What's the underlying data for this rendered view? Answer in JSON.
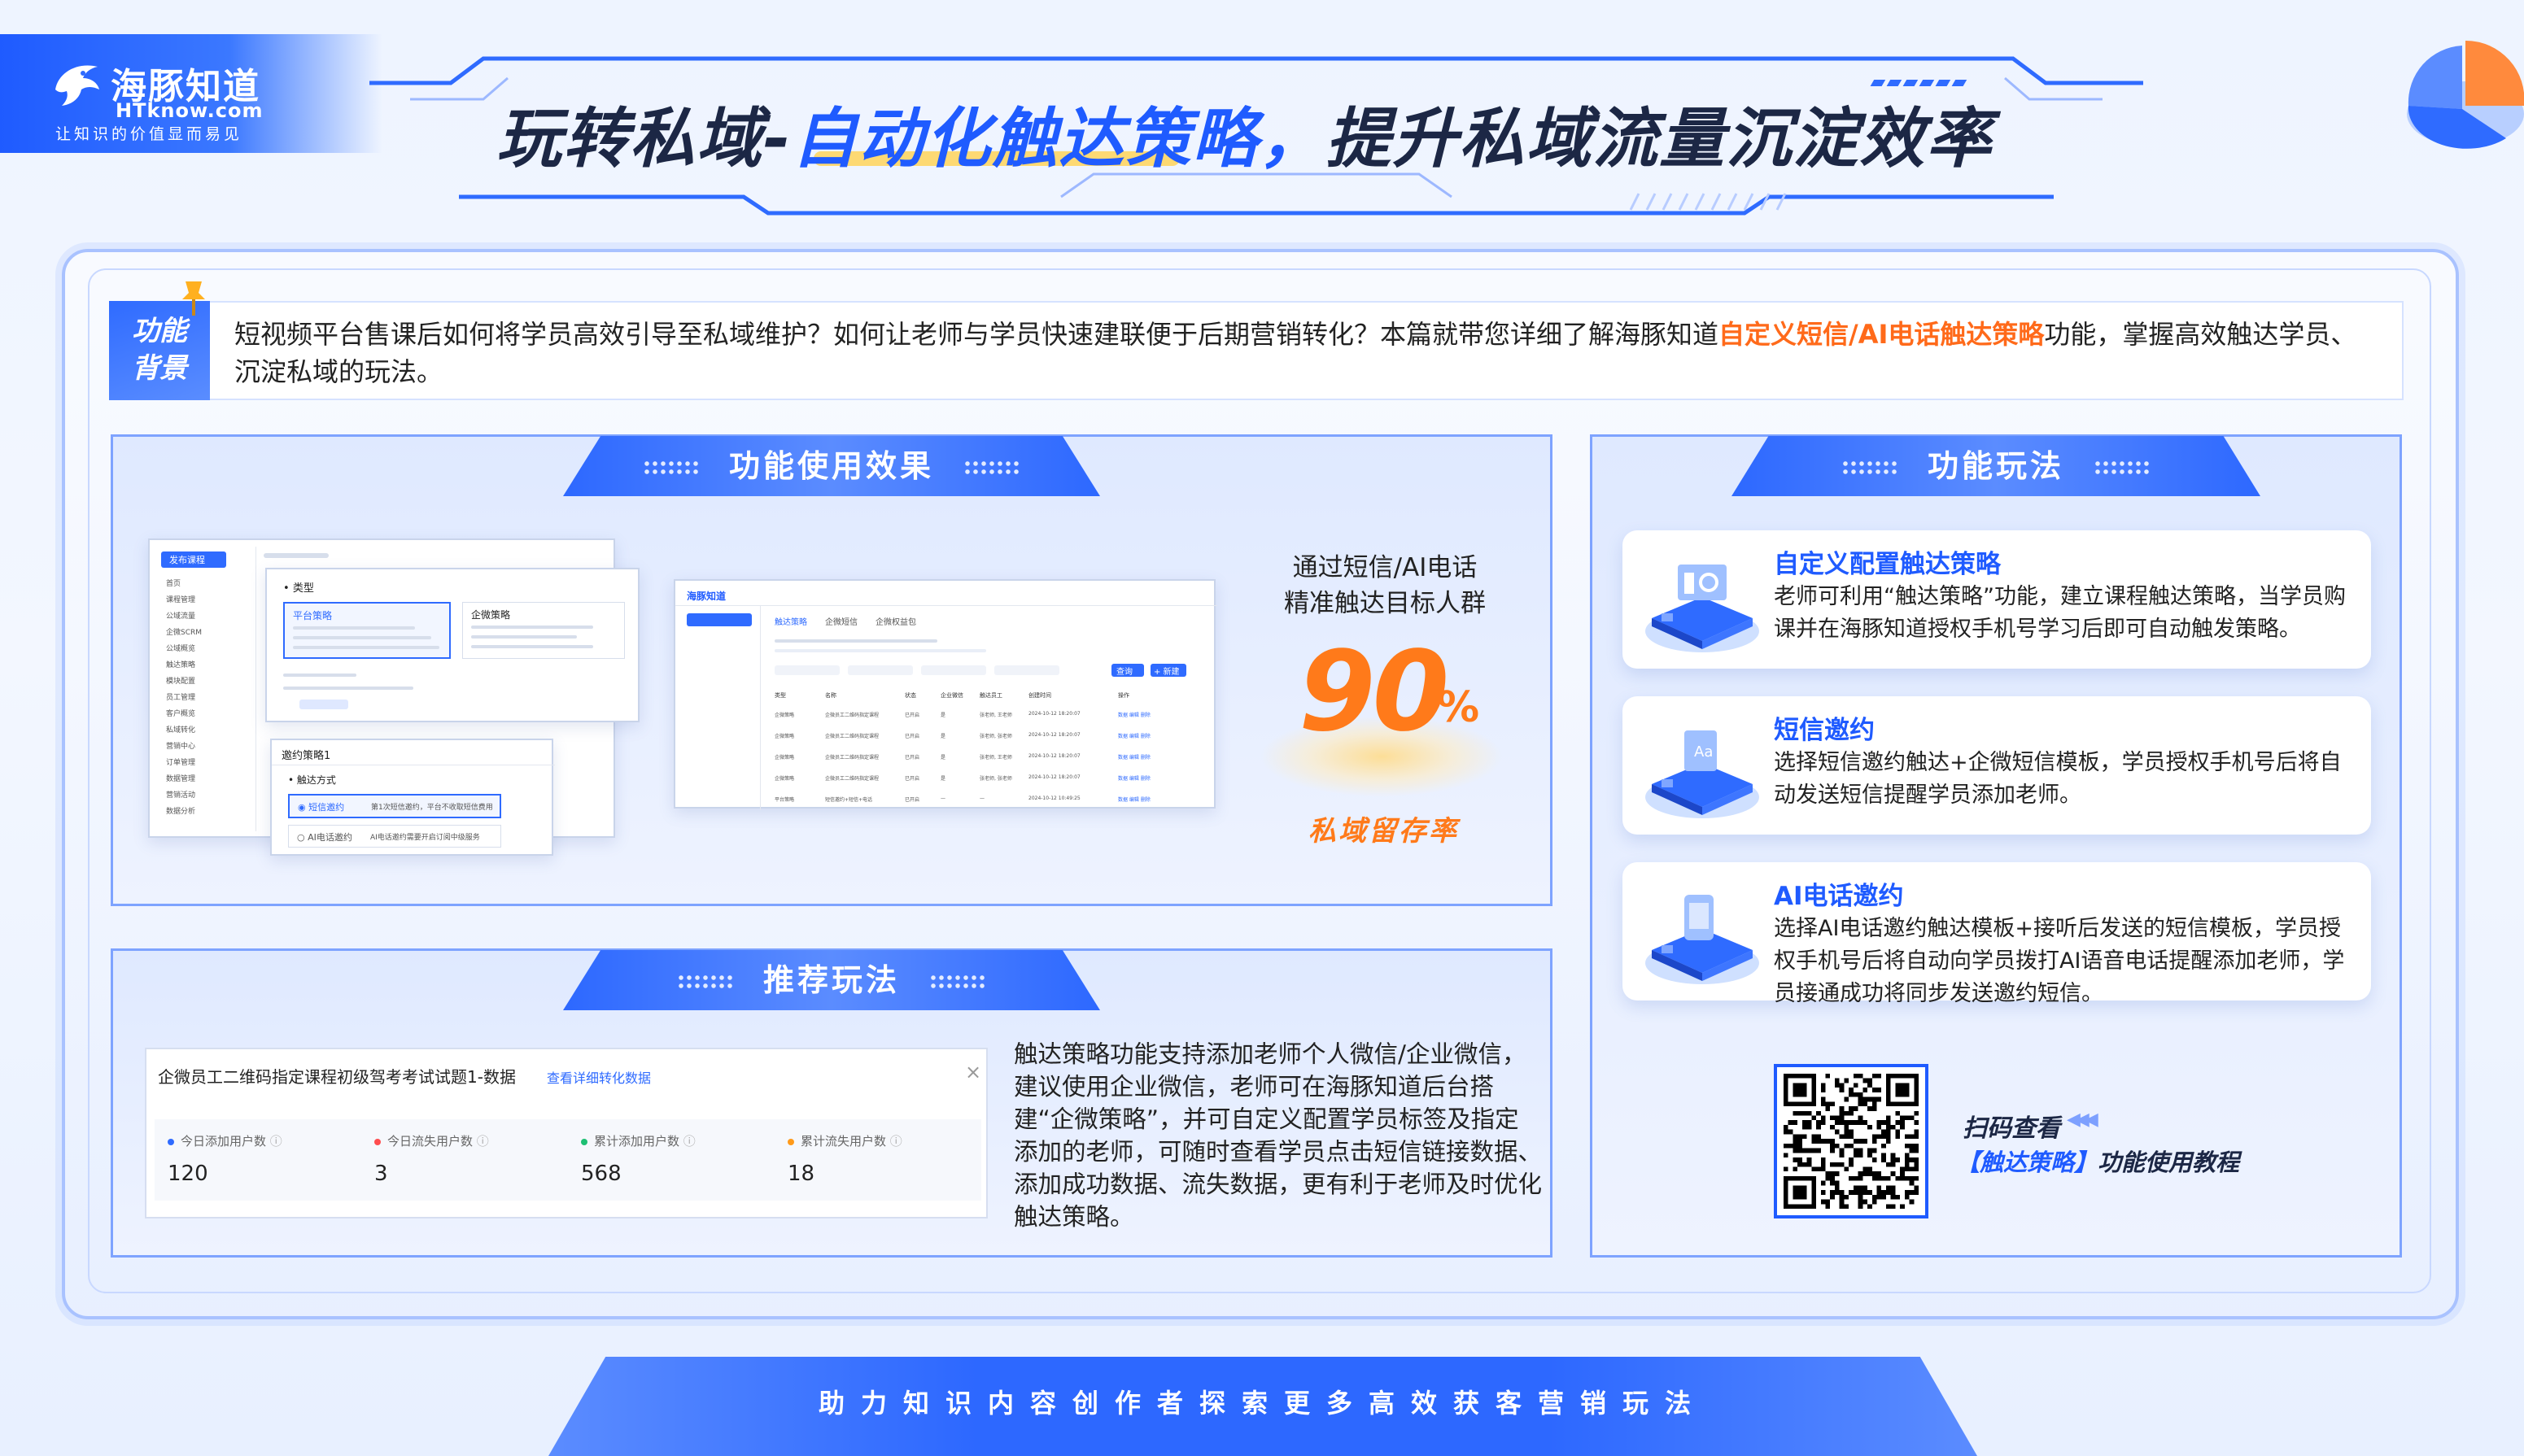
{
  "brand": {
    "name": "海豚知道",
    "domain": "HTknow.com",
    "slogan": "让知识的价值显而易见"
  },
  "header": {
    "title_part1": "玩转私域-",
    "title_part2": "自动化触达策略，",
    "title_part3": "提升私域流量沉淀效率"
  },
  "background": {
    "tag_line1": "功能",
    "tag_line2": "背景",
    "text_before": "短视频平台售课后如何将学员高效引导至私域维护？如何让老师与学员快速建联便于后期营销转化？本篇就带您详细了解海豚知道",
    "text_highlight": "自定义短信/AI电话触达策略",
    "text_after": "功能，掌握高效触达学员、沉淀私域的玩法。"
  },
  "effect": {
    "heading": "功能使用效果",
    "copy_line1": "通过短信/AI电话",
    "copy_line2": "精准触达目标人群",
    "number": "90",
    "unit": "%",
    "caption": "私域留存率",
    "shot1": {
      "menu": [
        "首页",
        "课程管理",
        "公域流量",
        "企微SCRM",
        "公域概览",
        "触达策略",
        "模块配置",
        "员工管理",
        "客户概览",
        "私域转化",
        "营销中心",
        "订单管理",
        "数据管理",
        "营销活动",
        "数据分析"
      ],
      "type_label": "类型",
      "opt1_title": "平台策略",
      "opt2_title": "企微策略",
      "popup_title": "邀约策略1",
      "popup_sub": "触达方式",
      "popup_opt1": "短信邀约",
      "popup_opt1_desc": "第1次短信邀约，平台不收取短信费用",
      "popup_opt2": "AI电话邀约",
      "popup_opt2_desc": "AI电话邀约需要开启订阅中级服务"
    },
    "shot2": {
      "logo": "海豚知道",
      "tabs": [
        "触达策略",
        "企微短信",
        "企微权益包"
      ],
      "search_btn": "查询",
      "add_btn": "+ 新建",
      "columns": [
        "类型",
        "名称",
        "状态",
        "企业微信",
        "触达员工",
        "创建时间",
        "操作"
      ],
      "rows": [
        [
          "企微策略",
          "企微员工二维码指定课程",
          "已开启",
          "是",
          "张老师, 王老师",
          "2024-10-12 18:20:07",
          "数据 编辑 删除"
        ],
        [
          "企微策略",
          "企微员工二维码指定课程",
          "已开启",
          "是",
          "张老师, 张老师",
          "2024-10-12 18:20:07",
          "数据 编辑 删除"
        ],
        [
          "企微策略",
          "企微员工二维码指定课程",
          "已开启",
          "是",
          "张老师, 王老师",
          "2024-10-12 18:20:07",
          "数据 编辑 删除"
        ],
        [
          "企微策略",
          "企微员工二维码指定课程",
          "已开启",
          "是",
          "张老师, 张老师",
          "2024-10-12 18:20:07",
          "数据 编辑 删除"
        ],
        [
          "平台策略",
          "短信邀约+短信+电话",
          "已开启",
          "—",
          "—",
          "2024-10-12 10:49:25",
          "数据 编辑 删除"
        ]
      ]
    }
  },
  "recommend": {
    "heading": "推荐玩法",
    "card_title": "企微员工二维码指定课程初级驾考考试试题1-数据",
    "card_link": "查看详细转化数据",
    "close": "×",
    "stats": [
      {
        "label": "今日添加用户数",
        "value": "120",
        "color": "#2f6bff"
      },
      {
        "label": "今日流失用户数",
        "value": "3",
        "color": "#ff4d4f"
      },
      {
        "label": "累计添加用户数",
        "value": "568",
        "color": "#1dbf73"
      },
      {
        "label": "累计流失用户数",
        "value": "18",
        "color": "#ff9a1a"
      }
    ],
    "text": "触达策略功能支持添加老师个人微信/企业微信，建议使用企业微信，老师可在海豚知道后台搭建“企微策略”，并可自定义配置学员标签及指定添加的老师，可随时查看学员点击短信链接数据、添加成功数据、流失数据，更有利于老师及时优化触达策略。"
  },
  "play": {
    "heading": "功能玩法",
    "items": [
      {
        "title": "自定义配置触达策略",
        "desc": "老师可利用“触达策略”功能，建立课程触达策略，当学员购课并在海豚知道授权手机号学习后即可自动触发策略。",
        "icon": "config-icon"
      },
      {
        "title": "短信邀约",
        "desc": "选择短信邀约触达+企微短信模板，学员授权手机号后将自动发送短信提醒学员添加老师。",
        "icon": "sms-icon"
      },
      {
        "title": "AI电话邀约",
        "desc": "选择AI电话邀约触达模板+接听后发送的短信模板，学员授权手机号后将自动向学员拨打AI语音电话提醒添加老师，学员接通成功将同步发送邀约短信。",
        "icon": "phone-icon"
      }
    ],
    "qr_tip1": "扫码查看",
    "qr_arrows": "◀◀◀",
    "qr_tip2_highlight": "【触达策略】",
    "qr_tip2_rest": "功能使用教程"
  },
  "footer": {
    "text": "助力知识内容创作者探索更多高效获客营销玩法"
  },
  "colors": {
    "primary": "#1f5bff",
    "accent": "#ff7a1a",
    "highlight": "#ff6a1a"
  }
}
